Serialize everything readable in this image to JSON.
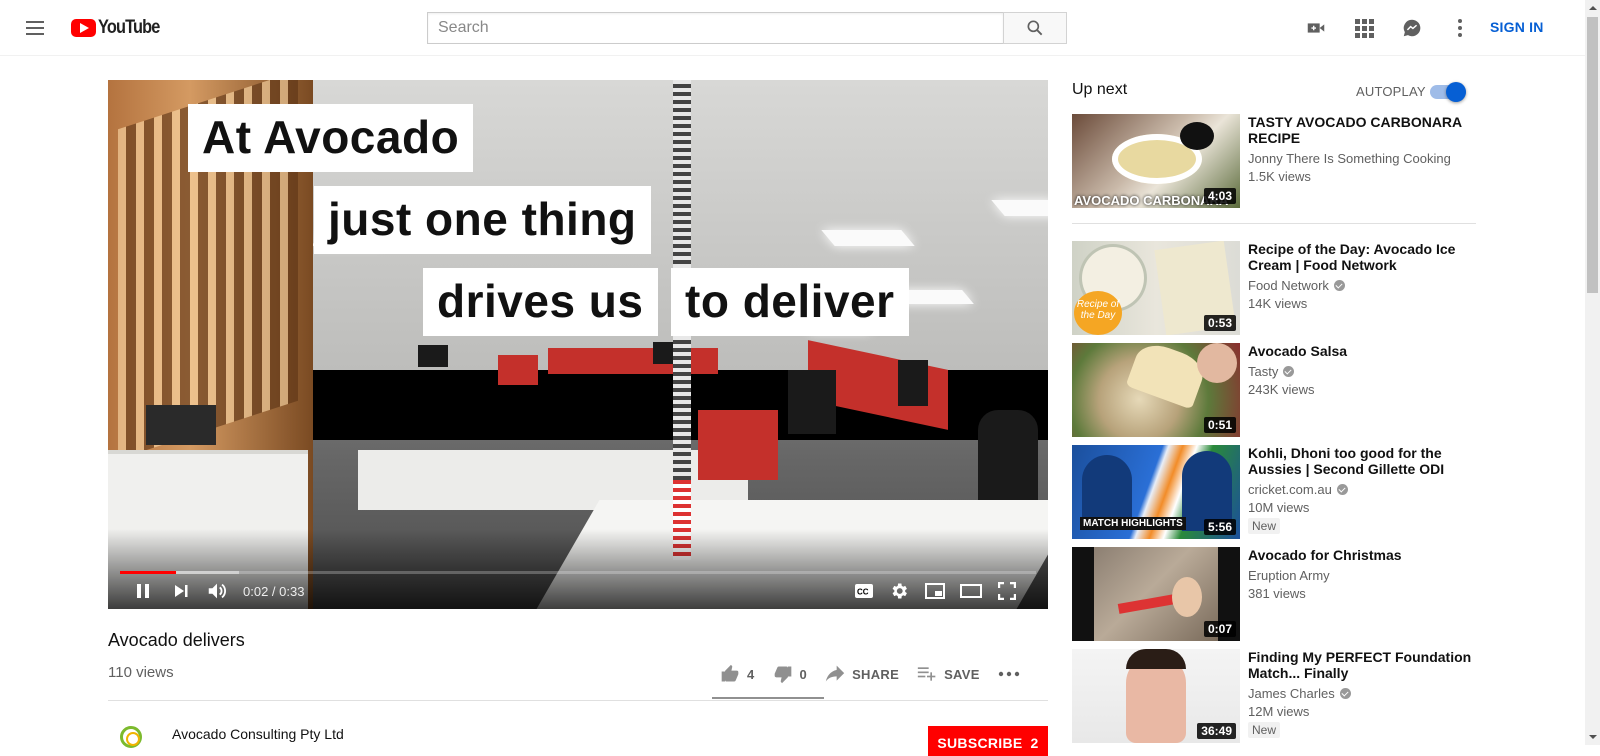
{
  "header": {
    "logo_text": "YouTube",
    "search_placeholder": "Search",
    "icons": [
      "create-video-icon",
      "apps-icon",
      "messages-icon",
      "more-icon"
    ],
    "sign_in": "SIGN IN"
  },
  "player": {
    "captions": [
      "At Avocado",
      "just one thing",
      "drives us",
      "to deliver"
    ],
    "time": "0:02 / 0:33",
    "progress_fraction": 0.061,
    "buffered_fraction": 0.13
  },
  "video": {
    "title": "Avocado delivers",
    "views": "110 views",
    "likes": "4",
    "dislikes": "0",
    "share_label": "SHARE",
    "save_label": "SAVE",
    "channel": "Avocado Consulting Pty Ltd",
    "subscribe_label": "SUBSCRIBE",
    "subscriber_count": "2"
  },
  "sidebar": {
    "up_next": "Up next",
    "autoplay": "AUTOPLAY",
    "autoplay_on": true,
    "items": [
      {
        "title": "TASTY AVOCADO CARBONARA RECIPE",
        "channel": "Jonny There Is Something Cooking",
        "views": "1.5K views",
        "duration": "4:03",
        "verified": false,
        "badge": "",
        "thumb_text": "AVOCADO CARBONARA"
      },
      {
        "title": "Recipe of the Day: Avocado Ice Cream | Food Network",
        "channel": "Food Network",
        "views": "14K views",
        "duration": "0:53",
        "verified": true,
        "badge": "",
        "thumb_text": "Recipe of the Day"
      },
      {
        "title": "Avocado Salsa",
        "channel": "Tasty",
        "views": "243K views",
        "duration": "0:51",
        "verified": true,
        "badge": "",
        "thumb_text": ""
      },
      {
        "title": "Kohli, Dhoni too good for the Aussies | Second Gillette ODI",
        "channel": "cricket.com.au",
        "views": "10M views",
        "duration": "5:56",
        "verified": true,
        "badge": "New",
        "thumb_text": "MATCH HIGHLIGHTS"
      },
      {
        "title": "Avocado for Christmas",
        "channel": "Eruption Army",
        "views": "381 views",
        "duration": "0:07",
        "verified": false,
        "badge": "",
        "thumb_text": ""
      },
      {
        "title": "Finding My PERFECT Foundation Match... Finally",
        "channel": "James Charles",
        "views": "12M views",
        "duration": "36:49",
        "verified": true,
        "badge": "New",
        "thumb_text": ""
      }
    ]
  },
  "colors": {
    "brand_red": "#ff0000",
    "link_blue": "#065fd4",
    "progress_red": "#ff0000"
  }
}
